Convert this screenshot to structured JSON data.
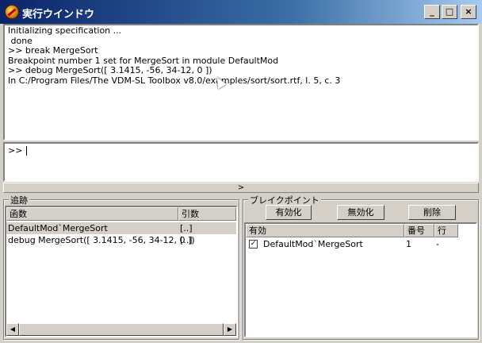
{
  "window": {
    "title": "実行ウインドウ",
    "buttons": {
      "minimize": "_",
      "maximize": "□",
      "close": "×"
    }
  },
  "output": {
    "lines": [
      "Initializing specification ...",
      " done",
      ">> break MergeSort",
      "Breakpoint number 1 set for MergeSort in module DefaultMod",
      ">> debug MergeSort([ 3.1415, -56, 34-12, 0 ])",
      "In C:/Program Files/The VDM-SL Toolbox v8.0/examples/sort/sort.rtf, l. 5, c. 3"
    ]
  },
  "input": {
    "prompt": ">> "
  },
  "splitter": {
    "glyph": ">"
  },
  "trace": {
    "label": "追跡",
    "columns": [
      "函数",
      "引数"
    ],
    "rows": [
      {
        "func": "DefaultMod`MergeSort",
        "args": "[..]"
      },
      {
        "func": "debug MergeSort([ 3.1415, -56, 34-12, 0 ])",
        "args": "[..]"
      }
    ]
  },
  "breakpoints": {
    "label": "ブレイクポイント",
    "enable_button": "有効化",
    "disable_button": "無効化",
    "delete_button": "削除",
    "columns": [
      "有効",
      "番号",
      "行"
    ],
    "rows": [
      {
        "checked": true,
        "name": "DefaultMod`MergeSort",
        "number": "1",
        "line": "-"
      }
    ]
  },
  "scroll": {
    "left": "◀",
    "right": "▶"
  }
}
